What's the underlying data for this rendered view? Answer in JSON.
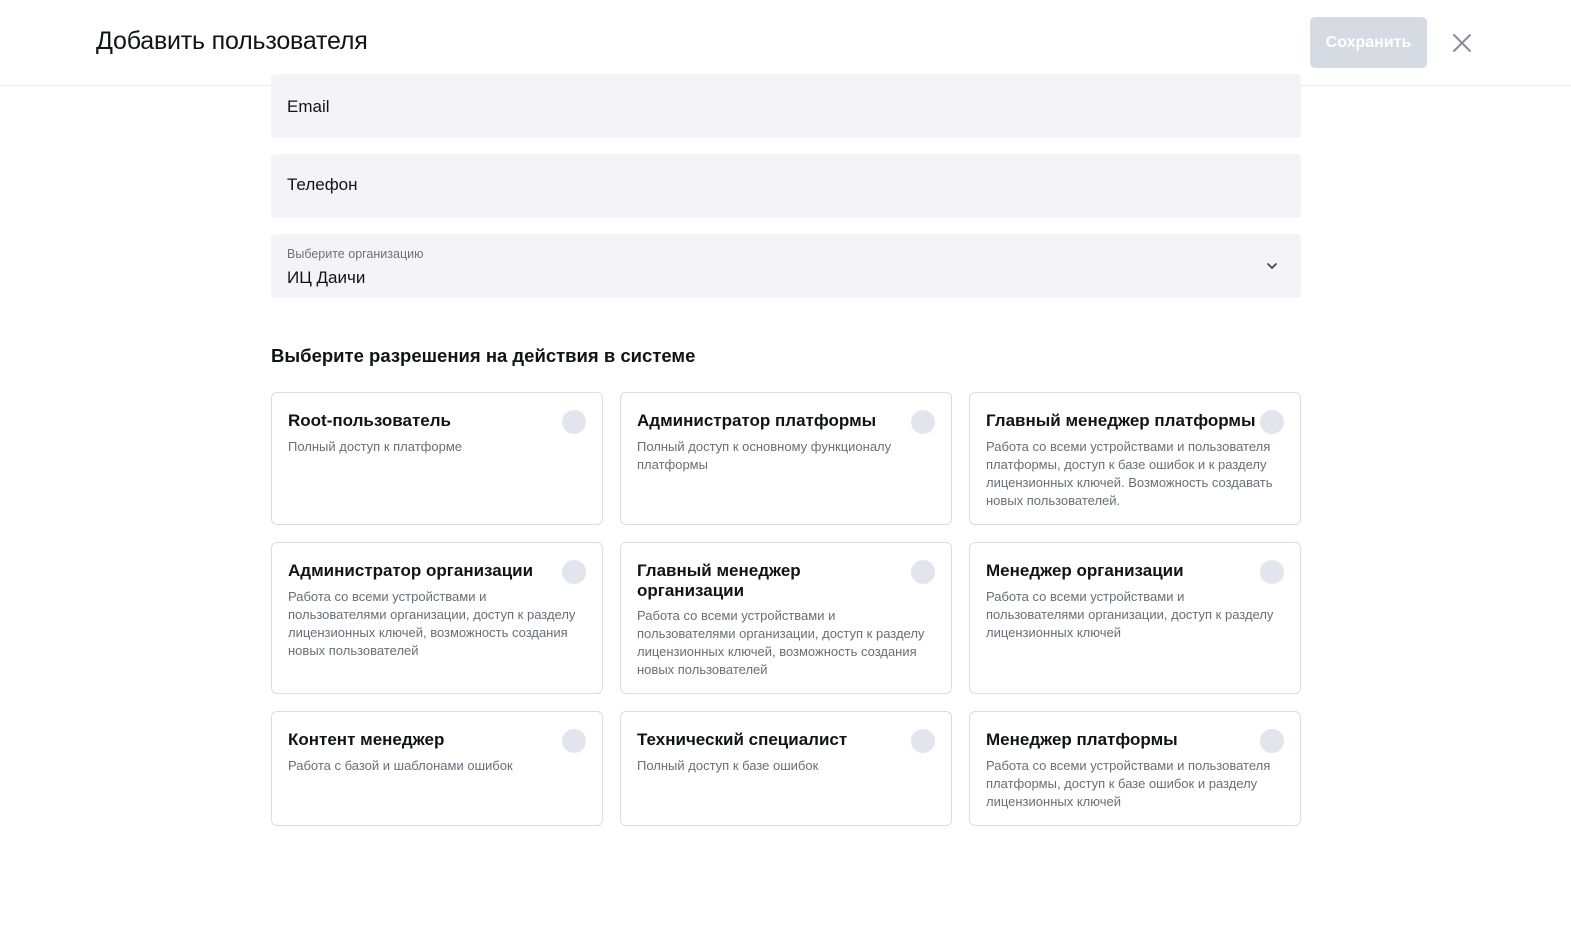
{
  "header": {
    "title": "Добавить пользователя",
    "save_label": "Сохранить",
    "close_icon": "close-icon"
  },
  "form": {
    "email_label": "Email",
    "phone_label": "Телефон",
    "org_label": "Выберите организацию",
    "org_value": "ИЦ Даичи"
  },
  "permissions": {
    "title": "Выберите разрешения на действия в системе",
    "items": [
      {
        "title": "Root-пользователь",
        "desc": "Полный доступ к платформе",
        "selected": false
      },
      {
        "title": "Администратор платформы",
        "desc": "Полный доступ к основному функционалу платформы",
        "selected": false
      },
      {
        "title": "Главный менеджер платформы",
        "desc": "Работа со всеми устройствами и пользователя платформы, доступ к базе ошибок и к разделу лицензионных ключей. Возможность создавать новых пользователей.",
        "selected": false
      },
      {
        "title": "Администратор организации",
        "desc": "Работа со всеми устройствами и пользователями организации, доступ к разделу лицензионных ключей, возможность создания новых пользователей",
        "selected": false
      },
      {
        "title": "Главный менеджер организации",
        "desc": "Работа со всеми устройствами и пользователями организации, доступ к разделу лицензионных ключей, возможность создания новых пользователей",
        "selected": false
      },
      {
        "title": "Менеджер организации",
        "desc": "Работа со всеми устройствами и пользователями организации, доступ к разделу лицензионных ключей",
        "selected": false
      },
      {
        "title": "Контент менеджер",
        "desc": "Работа с базой и шаблонами ошибок",
        "selected": false
      },
      {
        "title": "Технический специалист",
        "desc": "Полный доступ к базе ошибок",
        "selected": false
      },
      {
        "title": "Менеджер платформы",
        "desc": "Работа со всеми устройствами и пользователя платформы, доступ к базе ошибок и разделу лицензионных ключей",
        "selected": false
      }
    ]
  },
  "colors": {
    "save_disabled_bg": "#d5dae3",
    "field_bg": "#f4f4f8",
    "radio_bg": "#e3e5ee",
    "card_border": "#dcdde3"
  }
}
